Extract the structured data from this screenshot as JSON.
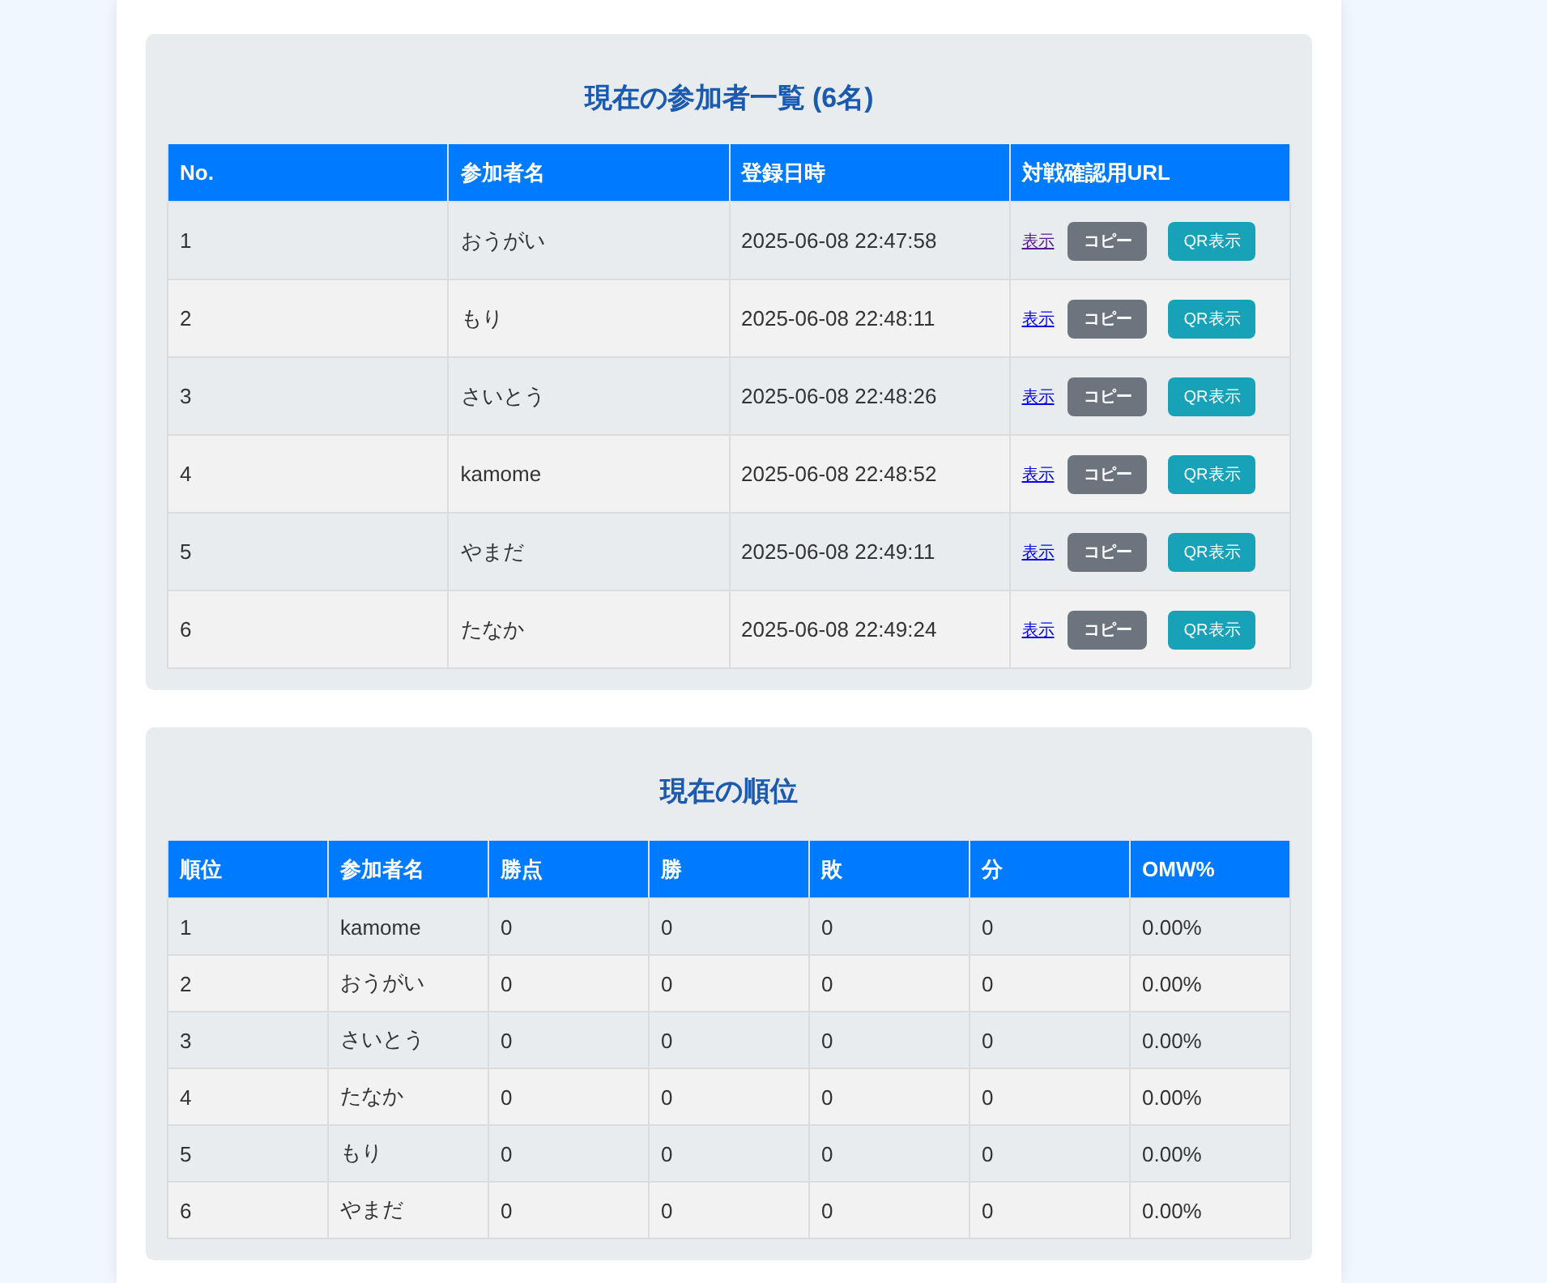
{
  "participants": {
    "title": "現在の参加者一覧 (6名)",
    "columns": [
      "No.",
      "参加者名",
      "登録日時",
      "対戦確認用URL"
    ],
    "rows": [
      {
        "no": "1",
        "name": "おうがい",
        "registered": "2025-06-08 22:47:58",
        "link": "表示",
        "link_visited": true,
        "copy": "コピー",
        "qr": "QR表示"
      },
      {
        "no": "2",
        "name": "もり",
        "registered": "2025-06-08 22:48:11",
        "link": "表示",
        "link_visited": false,
        "copy": "コピー",
        "qr": "QR表示"
      },
      {
        "no": "3",
        "name": "さいとう",
        "registered": "2025-06-08 22:48:26",
        "link": "表示",
        "link_visited": false,
        "copy": "コピー",
        "qr": "QR表示"
      },
      {
        "no": "4",
        "name": "kamome",
        "registered": "2025-06-08 22:48:52",
        "link": "表示",
        "link_visited": false,
        "copy": "コピー",
        "qr": "QR表示"
      },
      {
        "no": "5",
        "name": "やまだ",
        "registered": "2025-06-08 22:49:11",
        "link": "表示",
        "link_visited": false,
        "copy": "コピー",
        "qr": "QR表示"
      },
      {
        "no": "6",
        "name": "たなか",
        "registered": "2025-06-08 22:49:24",
        "link": "表示",
        "link_visited": false,
        "copy": "コピー",
        "qr": "QR表示"
      }
    ]
  },
  "standings": {
    "title": "現在の順位",
    "columns": [
      "順位",
      "参加者名",
      "勝点",
      "勝",
      "敗",
      "分",
      "OMW%"
    ],
    "rows": [
      [
        "1",
        "kamome",
        "0",
        "0",
        "0",
        "0",
        "0.00%"
      ],
      [
        "2",
        "おうがい",
        "0",
        "0",
        "0",
        "0",
        "0.00%"
      ],
      [
        "3",
        "さいとう",
        "0",
        "0",
        "0",
        "0",
        "0.00%"
      ],
      [
        "4",
        "たなか",
        "0",
        "0",
        "0",
        "0",
        "0.00%"
      ],
      [
        "5",
        "もり",
        "0",
        "0",
        "0",
        "0",
        "0.00%"
      ],
      [
        "6",
        "やまだ",
        "0",
        "0",
        "0",
        "0",
        "0.00%"
      ]
    ]
  }
}
